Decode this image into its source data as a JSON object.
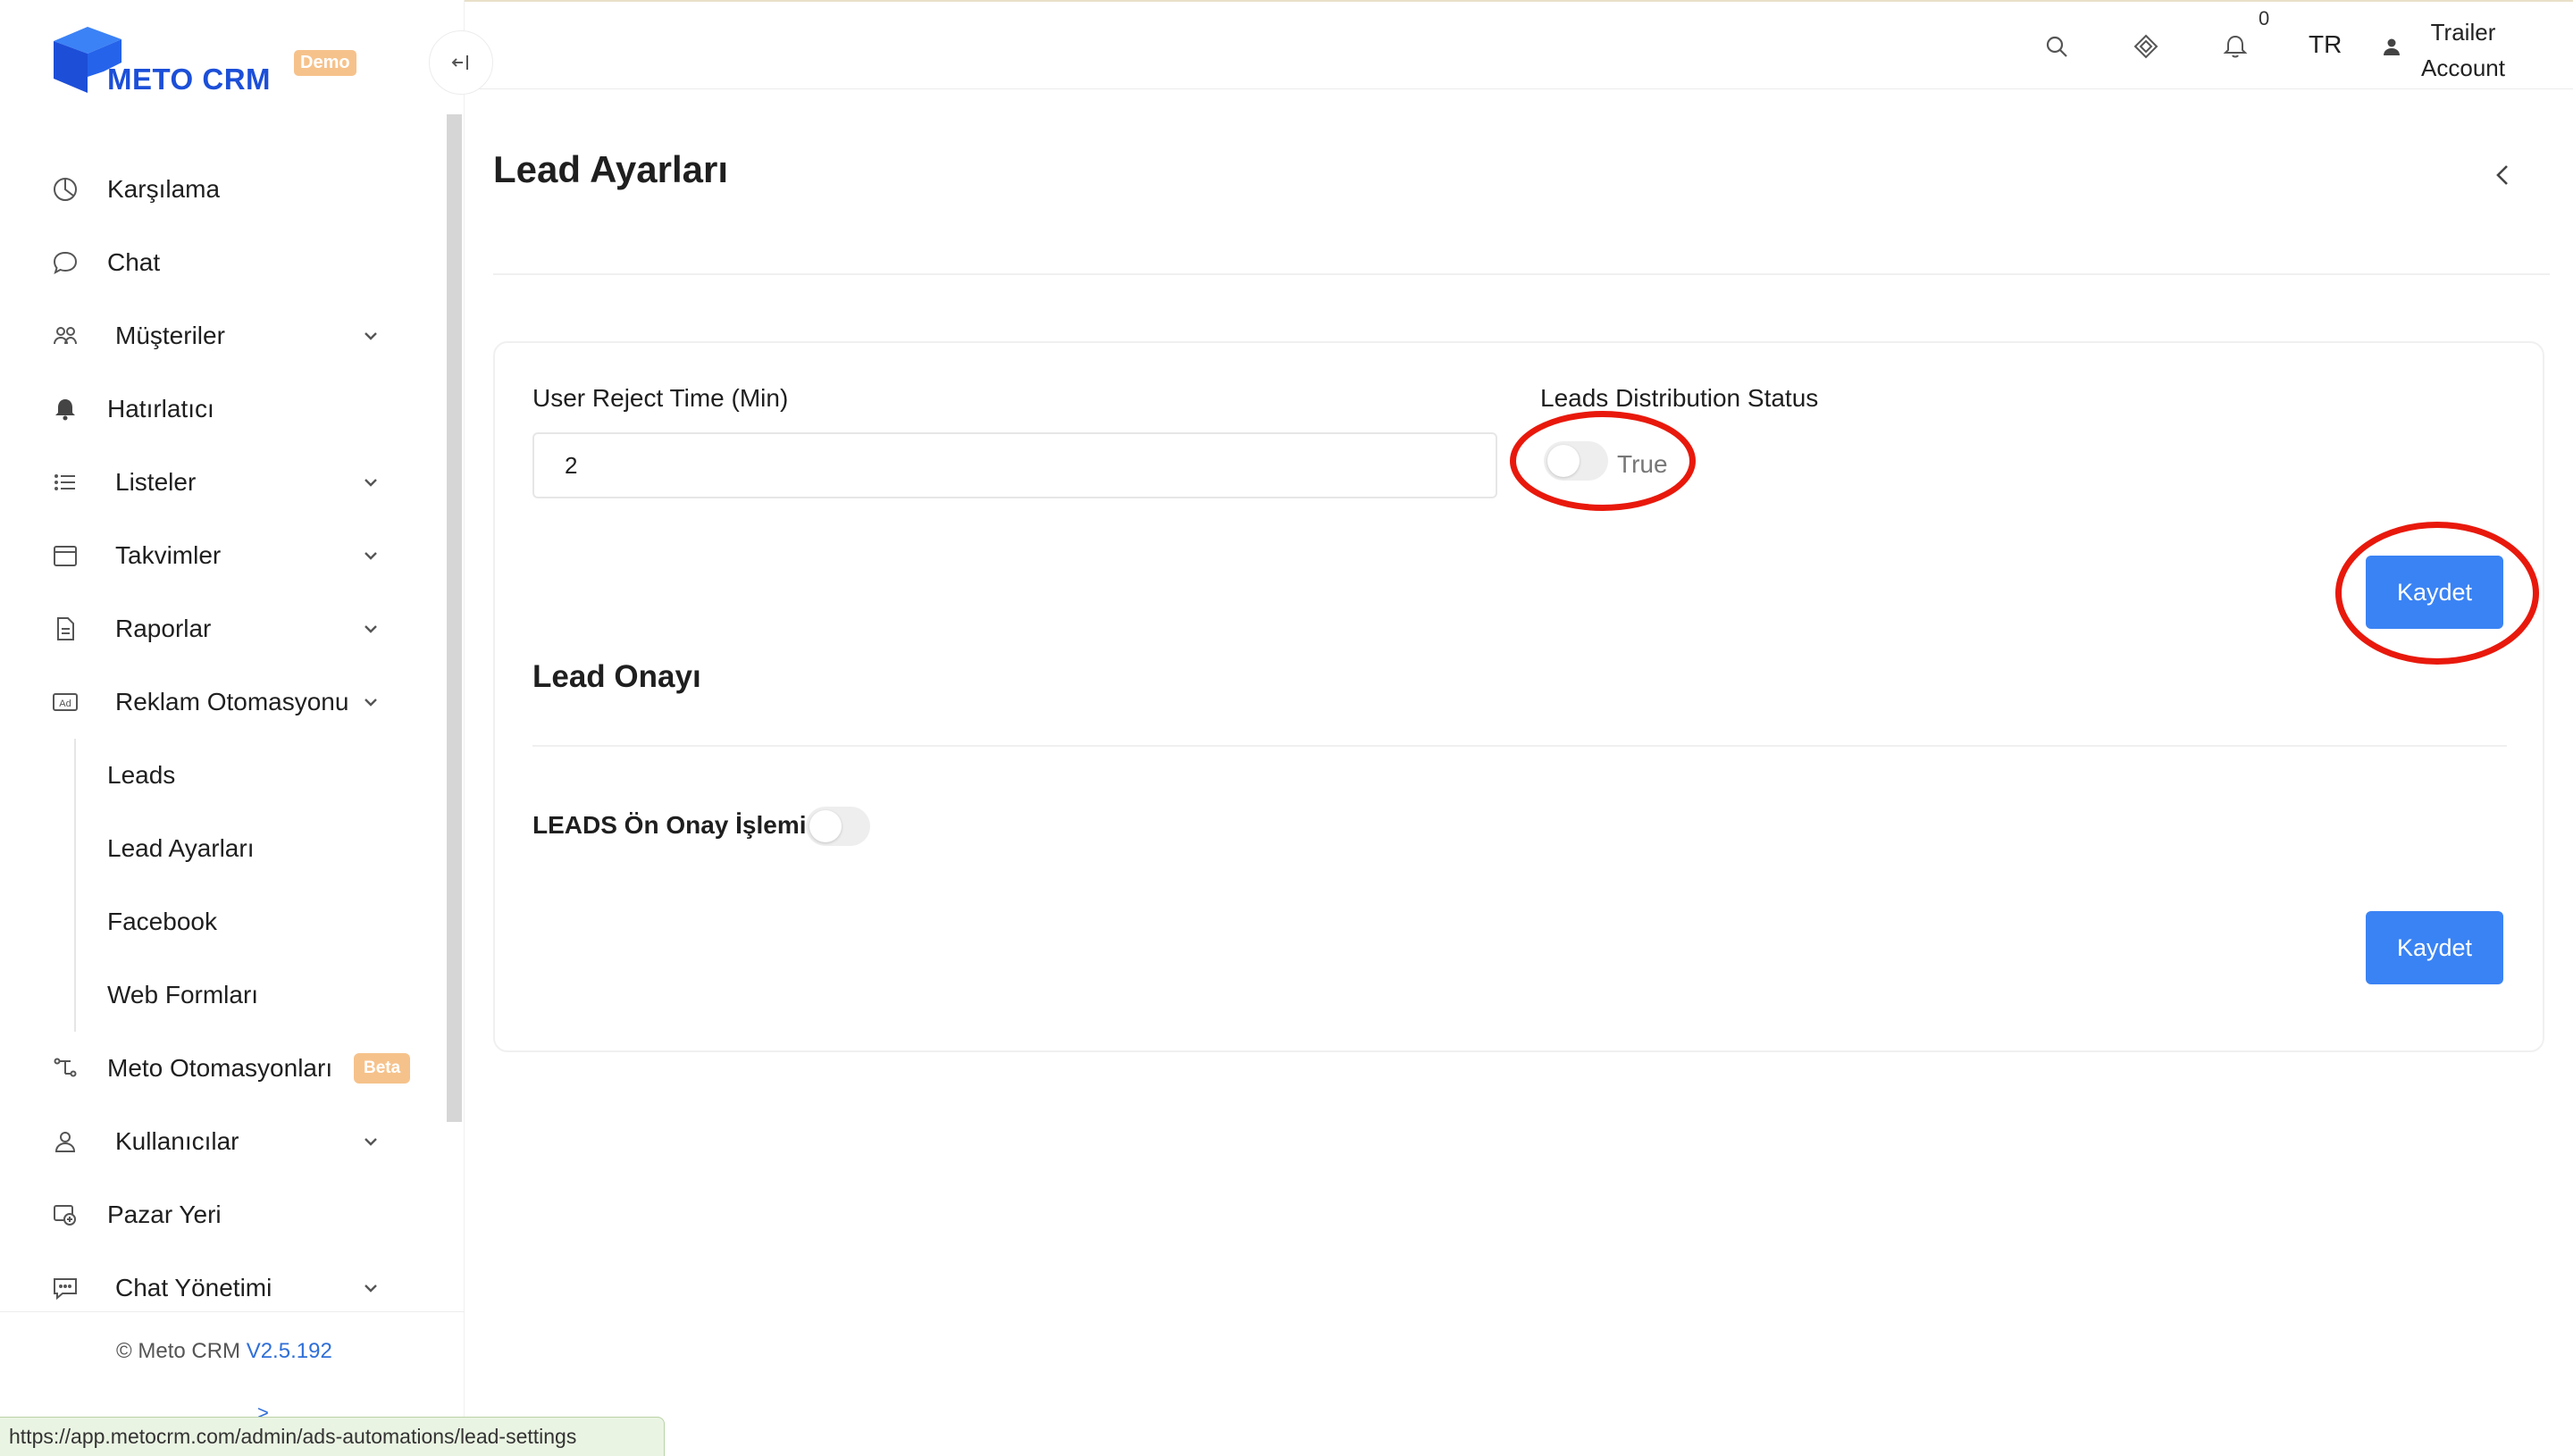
{
  "app": {
    "logo_text": "METO CRM",
    "logo_badge": "Demo",
    "brand_color": "#1c4fd8",
    "accent_color": "#3a83f4",
    "badge_color": "#f6c28b"
  },
  "sidebar": {
    "items": [
      {
        "label": "Karşılama",
        "icon": "pie-chart-icon",
        "has_sub": false
      },
      {
        "label": "Chat",
        "icon": "chat-bubble-icon",
        "has_sub": false
      },
      {
        "label": "Müşteriler",
        "icon": "users-icon",
        "has_sub": true
      },
      {
        "label": "Hatırlatıcı",
        "icon": "bell-icon",
        "has_sub": false
      },
      {
        "label": "Listeler",
        "icon": "list-icon",
        "has_sub": true
      },
      {
        "label": "Takvimler",
        "icon": "calendar-icon",
        "has_sub": true
      },
      {
        "label": "Raporlar",
        "icon": "report-icon",
        "has_sub": true
      },
      {
        "label": "Reklam Otomasyonu",
        "icon": "ad-icon",
        "has_sub": true,
        "expanded": true
      }
    ],
    "subitems": [
      {
        "label": "Leads"
      },
      {
        "label": "Lead Ayarları",
        "active": true
      },
      {
        "label": "Facebook"
      },
      {
        "label": "Web Formları"
      }
    ],
    "items_after": [
      {
        "label": "Meto Otomasyonları",
        "icon": "automation-icon",
        "badge": "Beta"
      },
      {
        "label": "Kullanıcılar",
        "icon": "user-icon",
        "has_sub": true
      },
      {
        "label": "Pazar Yeri",
        "icon": "marketplace-icon",
        "has_sub": false
      },
      {
        "label": "Chat Yönetimi",
        "icon": "chat-manage-icon",
        "has_sub": true
      }
    ],
    "footer": {
      "copyright": "© Meto CRM",
      "version": "V2.5.192"
    }
  },
  "header": {
    "notification_count": "0",
    "language": "TR",
    "account_name": "Trailer Account",
    "icons": [
      "search-icon",
      "apps-icon",
      "bell-icon",
      "user-icon"
    ]
  },
  "main": {
    "page_title": "Lead Ayarları",
    "form": {
      "reject_time_label": "User Reject Time (Min)",
      "reject_time_value": "2",
      "distribution_label": "Leads Distribution Status",
      "distribution_toggle_text": "True",
      "save_label": "Kaydet"
    },
    "approval": {
      "section_title": "Lead Onayı",
      "pre_approval_label": "LEADS Ön Onay İşlemi",
      "save_label": "Kaydet"
    }
  },
  "status_bar": {
    "url": "https://app.metocrm.com/admin/ads-automations/lead-settings"
  }
}
